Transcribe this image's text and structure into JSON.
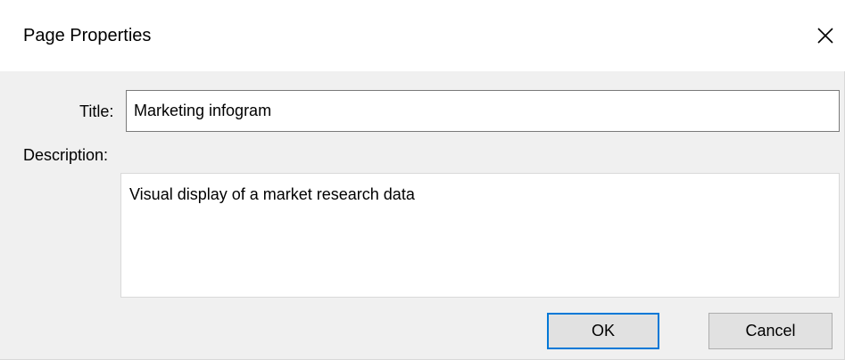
{
  "dialog": {
    "title": "Page Properties",
    "close_icon": "close-icon"
  },
  "form": {
    "title_label": "Title:",
    "title_value": "Marketing infogram",
    "description_label": "Description:",
    "description_value": "Visual display of a market research data"
  },
  "buttons": {
    "ok_label": "OK",
    "cancel_label": "Cancel"
  },
  "colors": {
    "focus_border": "#0078d7",
    "dialog_bg": "#f0f0f0",
    "button_bg": "#e1e1e1"
  }
}
